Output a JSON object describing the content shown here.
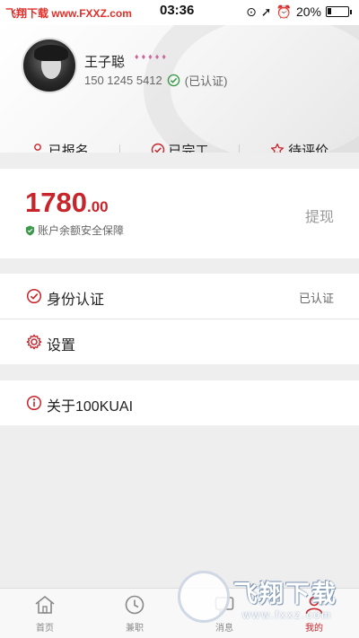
{
  "status_bar": {
    "watermark": "飞翔下载 www.FXXZ.com",
    "time": "03:36",
    "battery": "20%"
  },
  "profile": {
    "name": "王子聪",
    "rank_diamonds": "♦♦♦♦♦",
    "phone": "150 1245 5412",
    "verified_label": "(已认证)"
  },
  "order_tabs": [
    {
      "label": "已报名",
      "icon": "user-icon"
    },
    {
      "label": "已完工",
      "icon": "check-circle-icon"
    },
    {
      "label": "待评价",
      "icon": "star-icon"
    }
  ],
  "wallet": {
    "amount_int": "1780",
    "amount_dec": ".00",
    "note": "账户余额安全保障",
    "withdraw_label": "提现"
  },
  "menu": {
    "identity": {
      "label": "身份认证",
      "value": "已认证"
    },
    "settings": {
      "label": "设置"
    },
    "about": {
      "label": "关于100KUAI"
    }
  },
  "tabbar": [
    {
      "label": "首页",
      "icon": "home-icon"
    },
    {
      "label": "兼职",
      "icon": "clock-icon"
    },
    {
      "label": "消息",
      "icon": "message-icon"
    },
    {
      "label": "我的",
      "icon": "user-icon",
      "active": true
    }
  ],
  "watermark_overlay": {
    "text": "飞翔下载",
    "url": "www.fxxz.com"
  },
  "colors": {
    "accent": "#c8242b",
    "verified_green": "#3a9a4a"
  }
}
